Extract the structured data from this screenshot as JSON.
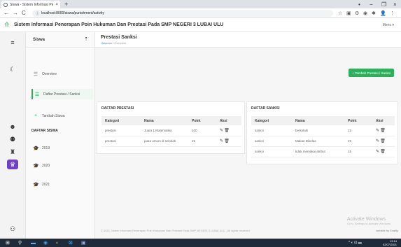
{
  "browser": {
    "tab_title": "Siswa - Sistem Informasi Penerap",
    "tab_close": "×",
    "new_tab": "+",
    "window_controls": [
      "•",
      "−",
      "❐",
      "×"
    ],
    "nav": {
      "back": "←",
      "forward": "→",
      "reload": "C"
    },
    "url_info": "ⓘ",
    "url": "localhost:8000/siswa/punishment/activity",
    "extension_icons": [
      "☆",
      "▣",
      "⚙",
      "◉",
      "✱",
      "👤",
      "⋮"
    ]
  },
  "app": {
    "title": "Sistem Informasi Penerapan Poin Hukuman Dan Prestasi Pada SMP NEGERI 3 LUBAI ULU",
    "menu_label": "Menu ▾"
  },
  "sidebar": {
    "title": "Siswa",
    "pin_icon": "⇡",
    "items": [
      {
        "label": "Overview",
        "icon": "☰"
      },
      {
        "label": "Daftar Prestasi / Sanksi",
        "icon": "☰"
      },
      {
        "label": "Tambah Siswa",
        "icon": "+"
      }
    ],
    "section_title": "DAFTAR SISWA",
    "years": [
      {
        "label": "2019",
        "icon": "🎓"
      },
      {
        "label": "2020",
        "icon": "🎓"
      },
      {
        "label": "2021",
        "icon": "🎓"
      }
    ]
  },
  "page": {
    "title": "Prestasi Sanksi",
    "breadcrumb_home": "Halaman",
    "breadcrumb_sep": " / ",
    "breadcrumb_current": "Overview",
    "add_button": "+  Tambah Prestasi / Sanksi"
  },
  "prestasi": {
    "title": "DAFTAR PRESTASI",
    "columns": [
      "Kategori",
      "Nama",
      "Point",
      "Aksi"
    ],
    "rows": [
      {
        "kategori": "prestasi",
        "nama": "Juara 1 Matematika",
        "point": "100"
      },
      {
        "kategori": "prestasi",
        "nama": "juara umum di sekolah",
        "point": "25"
      }
    ]
  },
  "sanksi": {
    "title": "DAFTAR SANKSI",
    "columns": [
      "Kategori",
      "Nama",
      "Point",
      "Aksi"
    ],
    "rows": [
      {
        "kategori": "sanksi",
        "nama": "berkelahi",
        "point": "15"
      },
      {
        "kategori": "sanksi",
        "nama": "Makan Dikelas",
        "point": "25"
      },
      {
        "kategori": "sanksi",
        "nama": "tidak memakai atribut",
        "point": "15"
      }
    ]
  },
  "actions": {
    "edit_icon": "✎",
    "delete_icon": "🗑"
  },
  "footer": {
    "text": "© 2021 Sistem Informasi Penerapan Poin Hukuman Dan Prestasi Pada SMP NEGERI 3 LUBAI ULU . All rights reserved.",
    "credit": "website by Exalify"
  },
  "watermark": {
    "line1": "Activate Windows",
    "line2": "Go to Settings to activate Windows."
  },
  "taskbar": {
    "start": "⊞",
    "search": "⚲",
    "apps": [
      "▬",
      "◉",
      "◐",
      "⊠",
      "▣"
    ],
    "tray": "^ ◐ ⊡ ▬",
    "time": "13.14",
    "date": "02/07/2021"
  },
  "colors": {
    "accent": "#2eaf5c",
    "rail_active": "#6f42c1",
    "link": "#3b8fd9"
  }
}
